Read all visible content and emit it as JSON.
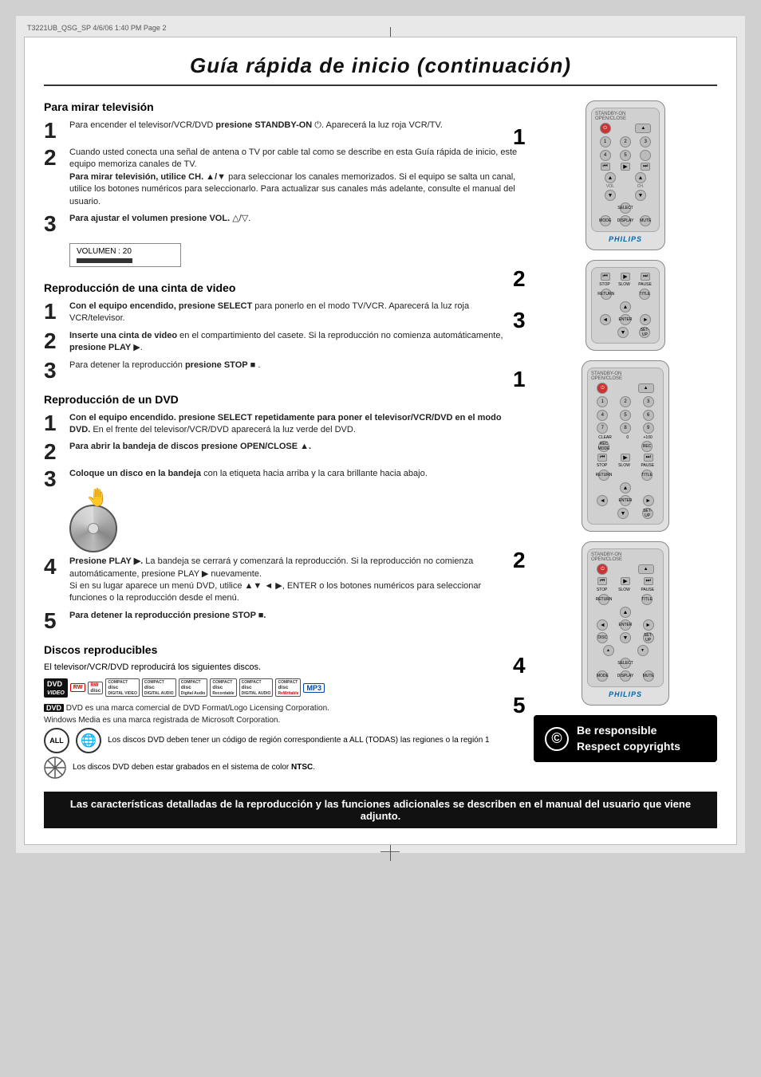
{
  "page": {
    "header_left": "T3221UB_QSG_SP  4/6/06  1:40 PM  Page 2",
    "title": "Guía rápida de inicio (continuación)",
    "section1": {
      "title": "Para mirar televisión",
      "steps": [
        {
          "num": "1",
          "text": "Para encender el televisor/VCR/DVD presione STANDBY-ON ⏻. Aparecerá la luz roja VCR/TV."
        },
        {
          "num": "2",
          "text": "Cuando usted conecta una señal de antena o TV por cable tal como se describe en esta Guía rápida de inicio, este equipo memoriza canales de TV.\nPara mirar televisión, utilice CH. ▲/▼ para seleccionar los canales memorizados. Si el equipo se salta un canal, utilice los botones numéricos para seleccionarlo. Para actualizar sus canales más adelante, consulte el manual del usuario."
        },
        {
          "num": "3",
          "text": "Para ajustar el volumen presione VOL. △/▽.",
          "vol_label": "VOLUMEN : 20"
        }
      ]
    },
    "section2": {
      "title": "Reproducción de una cinta de video",
      "steps": [
        {
          "num": "1",
          "text": "Con el equipo encendido, presione SELECT para ponerlo en el modo TV/VCR. Aparecerá la luz roja VCR/televisor."
        },
        {
          "num": "2",
          "text": "Inserte una cinta de video en el compartimiento del casete. Si la reproducción no comienza automáticamente, presione PLAY ▶."
        },
        {
          "num": "3",
          "text": "Para detener la reproducción presione STOP ■ ."
        }
      ]
    },
    "section3": {
      "title": "Reproducción de un DVD",
      "steps": [
        {
          "num": "1",
          "text": "Con el equipo encendido. presione SELECT repetidamente para poner el televisor/VCR/DVD en el modo DVD. En el frente del televisor/VCR/DVD aparecerá la luz verde del DVD."
        },
        {
          "num": "2",
          "text": "Para abrir la bandeja de discos presione OPEN/CLOSE ▲."
        },
        {
          "num": "3",
          "text": "Coloque un disco en la bandeja con la etiqueta hacia arriba y la cara brillante hacia abajo."
        },
        {
          "num": "4",
          "text": "Presione PLAY ▶. La bandeja se cerrará y comenzará la reproducción. Si la reproducción no comienza automáticamente, presione PLAY ▶ nuevamente.\nSi en su lugar aparece un menú DVD, utilice ▲▼ ◄ ▶, ENTER o los botones numéricos para seleccionar funciones o la reproducción desde el menú."
        },
        {
          "num": "5",
          "text": "Para detener la reproducción presione STOP ■."
        }
      ]
    },
    "section4": {
      "title": "Discos reproducibles",
      "intro": "El televisor/VCR/DVD  reproducirá los siguientes discos.",
      "dvd_trademark": "DVD es una marca comercial de DVD Format/Logo Licensing Corporation.",
      "windows_trademark": "Windows Media es una marca registrada de Microsoft Corporation.",
      "region_text": "Los discos DVD deben tener un código de región correspondiente a ALL (TODAS) las regiones o la región 1",
      "ntsc_text": "Los discos DVD deben estar grabados en el sistema de color NTSC.",
      "bottom_notice": "Las características detalladas de la reproducción y las funciones adicionales se describen en el manual del usuario que viene adjunto."
    },
    "responsible": {
      "line1": "Be responsible",
      "line2": "Respect copyrights"
    },
    "philips": "PHILIPS"
  }
}
